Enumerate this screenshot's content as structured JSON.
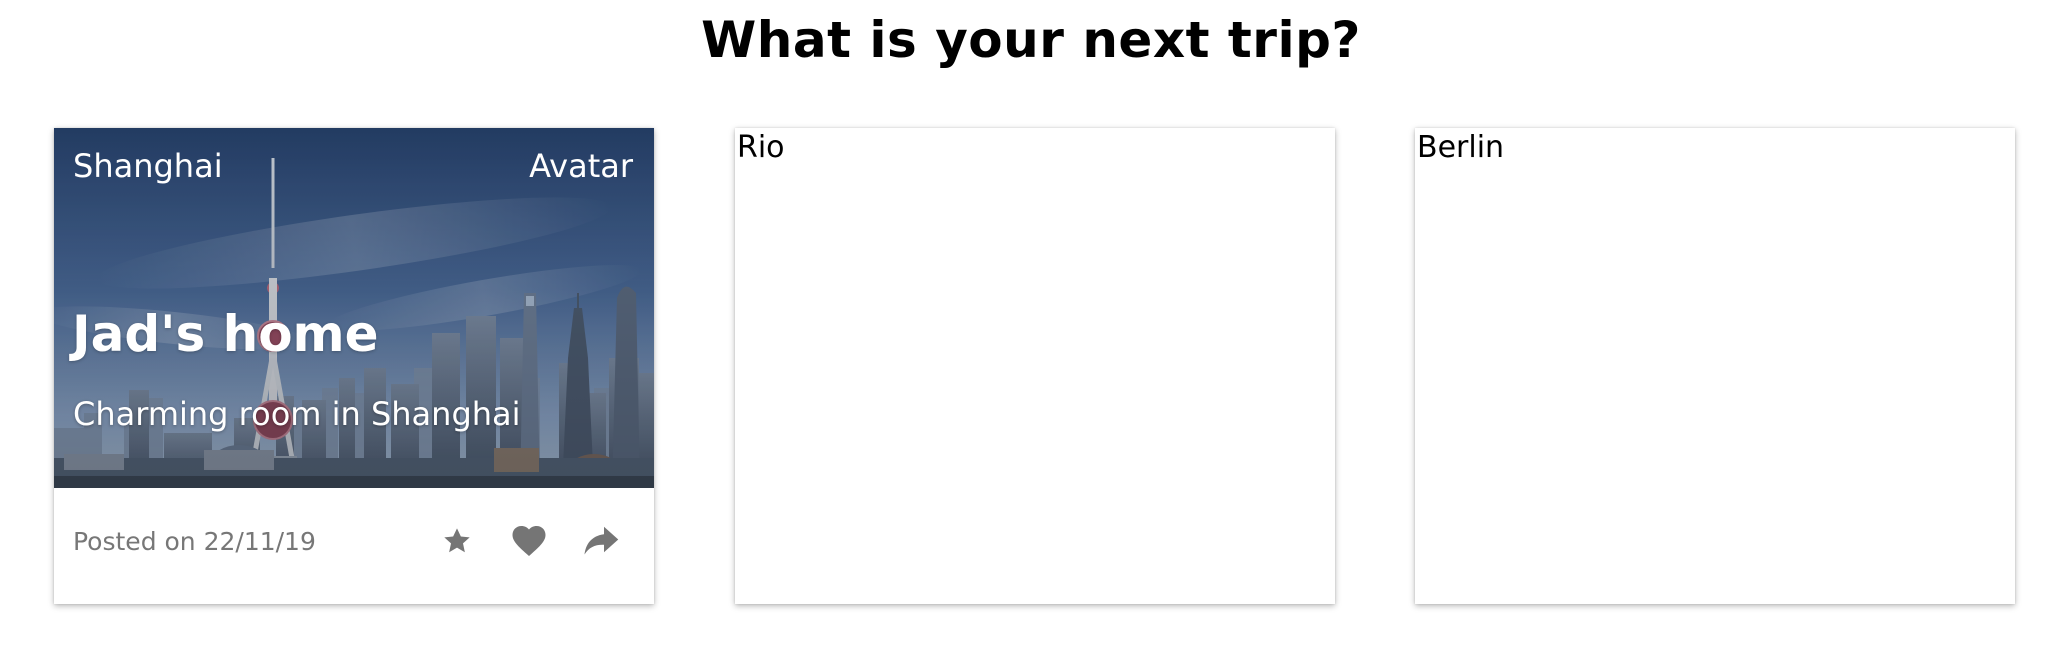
{
  "page": {
    "title": "What is your next trip?"
  },
  "cards": [
    {
      "city": "Shanghai",
      "avatar": "Avatar",
      "title": "Jad's home",
      "subtitle": "Charming room in Shanghai",
      "posted": "Posted on 22/11/19",
      "actions": [
        {
          "icon": "star-icon"
        },
        {
          "icon": "heart-icon"
        },
        {
          "icon": "share-icon"
        }
      ],
      "image": "shanghai-skyline"
    },
    {
      "label": "Rio"
    },
    {
      "label": "Berlin"
    }
  ],
  "colors": {
    "action_icon": "#757575",
    "muted_text": "#777777",
    "sky_top": "#2d4a75",
    "sky_bottom": "#6f8fb8"
  }
}
